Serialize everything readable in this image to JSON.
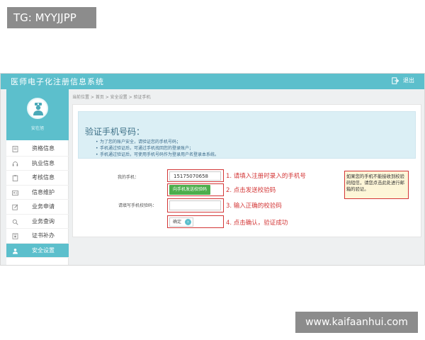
{
  "watermarks": {
    "top": "TG: MYYJJPP",
    "bottom": "www.kaifaanhui.com"
  },
  "app": {
    "title": "医师电子化注册信息系统",
    "logout_label": "退出"
  },
  "user": {
    "name": "安在旭"
  },
  "sidebar": {
    "items": [
      {
        "label": "资格信息",
        "icon": "document-icon",
        "active": false
      },
      {
        "label": "执业信息",
        "icon": "headset-icon",
        "active": false
      },
      {
        "label": "考核信息",
        "icon": "clipboard-icon",
        "active": false
      },
      {
        "label": "信息维护",
        "icon": "id-card-icon",
        "active": false
      },
      {
        "label": "业务申请",
        "icon": "edit-icon",
        "active": false
      },
      {
        "label": "业务查询",
        "icon": "search-icon",
        "active": false
      },
      {
        "label": "证书补办",
        "icon": "certificate-icon",
        "active": false
      },
      {
        "label": "安全设置",
        "icon": "user-icon",
        "active": true
      }
    ]
  },
  "breadcrumb": "当前位置 > 首页 > 安全设置 > 验证手机",
  "info": {
    "title": "验证手机号码：",
    "bullets": [
      "为了您的账户安全，请验证您的手机号码；",
      "手机通过验证后，可通过手机找回您的登录账户；",
      "手机通过验证后，可使用手机号码作为登录用户名登录本系统。"
    ]
  },
  "form": {
    "phone_label": "我的手机：",
    "phone_value": "15175070658",
    "sms_button": "向手机发送校验码",
    "code_label": "请填写手机校验码：",
    "code_value": "",
    "confirm_label": "确定"
  },
  "steps": {
    "s1": "1. 请填入注册时录入的手机号",
    "s2": "2. 点击发送校验码",
    "s3": "3. 输入正确的校验码",
    "s4": "4. 点击确认，验证成功"
  },
  "note": "如果您的手机不能接收到校验码短信，请您点击此处进行邮箱的验证。",
  "colors": {
    "accent": "#5cbfcc",
    "highlight": "#d33636",
    "button_green": "#4cae4c",
    "info_bg": "#dbeff5"
  }
}
